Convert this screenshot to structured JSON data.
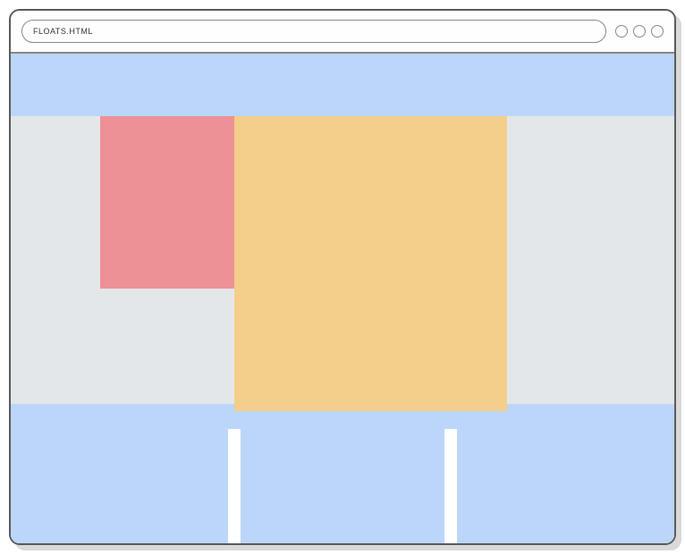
{
  "browser": {
    "url": "FLOATS.HTML"
  },
  "layout": {
    "header_color": "#bbd6f9",
    "content_bg": "#e4e7e9",
    "float1_color": "#ee9197",
    "float2_color": "#f4ce8b",
    "footer_col_color": "#bbd6f9"
  }
}
